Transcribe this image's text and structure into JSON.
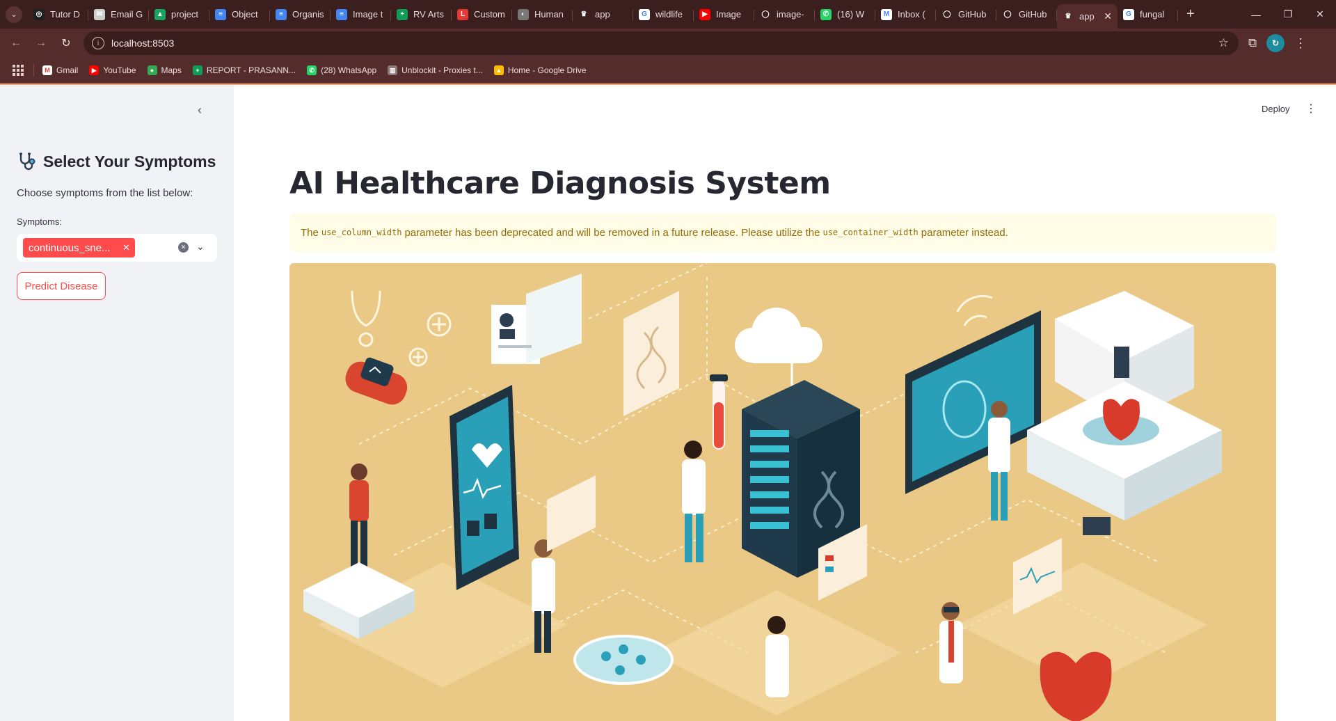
{
  "browser": {
    "tabs": [
      {
        "title": "Tutor D",
        "icon": "globe-icon",
        "color": "#1f1f1f",
        "glyph": "◎"
      },
      {
        "title": "Email G",
        "icon": "mail-icon",
        "color": "#cfcfcf",
        "glyph": "✉"
      },
      {
        "title": "project",
        "icon": "drive-icon",
        "color": "#1aa260",
        "glyph": "▲"
      },
      {
        "title": "Object",
        "icon": "docs-icon",
        "color": "#4285f4",
        "glyph": "≡"
      },
      {
        "title": "Organis",
        "icon": "docs-icon",
        "color": "#4285f4",
        "glyph": "≡"
      },
      {
        "title": "Image t",
        "icon": "docs-icon",
        "color": "#4285f4",
        "glyph": "≡"
      },
      {
        "title": "RV Arts",
        "icon": "sheets-icon",
        "color": "#0f9d58",
        "glyph": "+"
      },
      {
        "title": "Custom",
        "icon": "l-icon",
        "color": "#e53935",
        "glyph": "L"
      },
      {
        "title": "Human",
        "icon": "globe-icon",
        "color": "#777777",
        "glyph": "◐"
      },
      {
        "title": "app",
        "icon": "streamlit-icon",
        "color": "#3b1f1f",
        "glyph": "♛"
      },
      {
        "title": "wildlife",
        "icon": "google-icon",
        "color": "#ffffff",
        "glyph": "G"
      },
      {
        "title": "Image",
        "icon": "youtube-icon",
        "color": "#ff0000",
        "glyph": "▶"
      },
      {
        "title": "image-",
        "icon": "github-icon",
        "color": "#3b1f1f",
        "glyph": "◯"
      },
      {
        "title": "(16) W",
        "icon": "whatsapp-icon",
        "color": "#25d366",
        "glyph": "✆"
      },
      {
        "title": "Inbox (",
        "icon": "gmail-icon",
        "color": "#ffffff",
        "glyph": "M"
      },
      {
        "title": "GitHub",
        "icon": "github-icon",
        "color": "#3b1f1f",
        "glyph": "◯"
      },
      {
        "title": "GitHub",
        "icon": "github-icon",
        "color": "#3b1f1f",
        "glyph": "◯"
      },
      {
        "title": "app",
        "icon": "streamlit-icon",
        "color": "#552c2c",
        "glyph": "♛",
        "active": true
      },
      {
        "title": "fungal",
        "icon": "google-icon",
        "color": "#ffffff",
        "glyph": "G"
      }
    ],
    "url": "localhost:8503",
    "bookmarks": [
      {
        "label": "Gmail",
        "icon": "gmail-icon",
        "color": "#ffffff",
        "glyph": "M"
      },
      {
        "label": "YouTube",
        "icon": "youtube-icon",
        "color": "#ff0000",
        "glyph": "▶"
      },
      {
        "label": "Maps",
        "icon": "maps-icon",
        "color": "#34a853",
        "glyph": "●"
      },
      {
        "label": "REPORT - PRASANN...",
        "icon": "sheets-icon",
        "color": "#0f9d58",
        "glyph": "+"
      },
      {
        "label": "(28) WhatsApp",
        "icon": "whatsapp-icon",
        "color": "#25d366",
        "glyph": "✆"
      },
      {
        "label": "Unblockit - Proxies t...",
        "icon": "unblockit-icon",
        "color": "#8a7a7a",
        "glyph": "▥"
      },
      {
        "label": "Home - Google Drive",
        "icon": "drive-icon",
        "color": "#fbbc04",
        "glyph": "▲"
      }
    ]
  },
  "app": {
    "deploy_label": "Deploy",
    "sidebar": {
      "title": "Select Your Symptoms",
      "subtitle": "Choose symptoms from the list below:",
      "field_label": "Symptoms:",
      "selected_chip": "continuous_sne...",
      "button_label": "Predict Disease"
    },
    "main": {
      "title": "AI Healthcare Diagnosis System",
      "warning": {
        "text_1": "The",
        "code_1": "use_column_width",
        "text_2": "parameter has been deprecated and will be removed in a future release. Please utilize the",
        "code_2": "use_container_width",
        "text_3": "parameter instead."
      },
      "hero_image": "healthcare-illustration"
    }
  },
  "colors": {
    "primary": "#ff4b4b",
    "sidebar_bg": "#f0f2f6",
    "warning_bg": "#fffce7",
    "warning_text": "#926c05",
    "hero_bg": "#eac885"
  }
}
